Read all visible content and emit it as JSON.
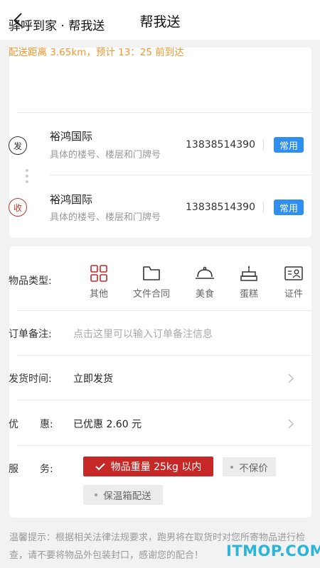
{
  "navbar": {
    "title": "帮我送"
  },
  "route": {
    "title": "驿呼到家 · 帮我送",
    "summary": "配送距离 3.65km，预计 13：25 前到达"
  },
  "sender": {
    "icon_text": "发",
    "name": "裕鸿国际",
    "hint": "具体的楼号、楼层和门牌号",
    "phone": "13838514390",
    "tag": "常用"
  },
  "receiver": {
    "icon_text": "收",
    "name": "裕鸿国际",
    "hint": "具体的楼号、楼层和门牌号",
    "phone": "13838514390",
    "tag": "常用"
  },
  "goods": {
    "label": "物品类型:",
    "types": [
      {
        "label": "其他",
        "icon": "grid-icon",
        "selected": true
      },
      {
        "label": "文件合同",
        "icon": "folder-icon",
        "selected": false
      },
      {
        "label": "美食",
        "icon": "dish-cover-icon",
        "selected": false
      },
      {
        "label": "蛋糕",
        "icon": "cake-icon",
        "selected": false
      },
      {
        "label": "证件",
        "icon": "id-card-icon",
        "selected": false
      }
    ]
  },
  "remark": {
    "label": "订单备注:",
    "placeholder": "点击这里可以输入订单备注信息"
  },
  "send_time": {
    "label": "发货时间:",
    "value": "立即发货"
  },
  "discount": {
    "label1": "优",
    "label2": "惠:",
    "value": "已优惠 2.60 元"
  },
  "service": {
    "label1": "服",
    "label2": "务:",
    "options": [
      {
        "label": "物品重量 25kg 以内",
        "selected": true
      },
      {
        "label": "不保价",
        "selected": false
      },
      {
        "label": "保温箱配送",
        "selected": false
      }
    ]
  },
  "notice": "温馨提示：根据相关法律法规要求，跑男将在取货时对您所寄物品进行检查，请不要将物品外包装封口，感谢您的配合！",
  "watermark": "ITMOP.COM",
  "colors": {
    "accent_red": "#c62828",
    "accent_orange": "#f0962d",
    "tag_blue": "#2e8ff0"
  }
}
